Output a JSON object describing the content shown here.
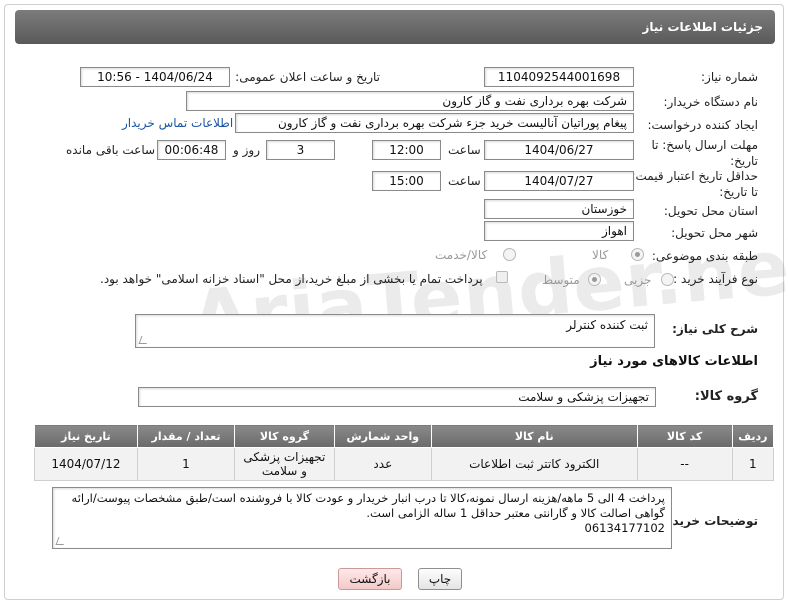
{
  "header": {
    "title": "جزئیات اطلاعات نیاز"
  },
  "form": {
    "need_number": {
      "label": "شماره نیاز:",
      "value": "1104092544001698"
    },
    "announce_datetime": {
      "label": "تاریخ و ساعت اعلان عمومی:",
      "value": "1404/06/24 - 10:56"
    },
    "buyer_org": {
      "label": "نام دستگاه خریدار:",
      "value": "شرکت بهره برداری نفت و گاز کارون"
    },
    "requester": {
      "label": "ایجاد کننده درخواست:",
      "value": "پیغام پوراتیان آنالیست خرید جزء شرکت بهره برداری نفت و گاز کارون",
      "contact_link": "اطلاعات تماس خریدار"
    },
    "reply_deadline": {
      "label": "مهلت ارسال پاسخ: تا تاریخ:",
      "date": "1404/06/27",
      "time_label": "ساعت",
      "time": "12:00",
      "days": "3",
      "days_label": "روز و",
      "remaining": "00:06:48",
      "remaining_label": "ساعت باقی مانده"
    },
    "price_validity": {
      "label": "حداقل تاریخ اعتبار قیمت: تا تاریخ:",
      "date": "1404/07/27",
      "time_label": "ساعت",
      "time": "15:00"
    },
    "province": {
      "label": "استان محل تحویل:",
      "value": "خوزستان"
    },
    "city": {
      "label": "شهر محل تحویل:",
      "value": "اهواز"
    },
    "category": {
      "label": "طبقه بندی موضوعی:",
      "options": [
        "کالا",
        "کالا/خدمت"
      ],
      "selected": "کالا"
    },
    "process": {
      "label": "نوع فرآیند خرید :",
      "options": [
        "جزیی",
        "متوسط"
      ],
      "selected": "متوسط",
      "payment_note": "پرداخت تمام یا بخشی از مبلغ خرید،از محل \"اسناد خزانه اسلامی\" خواهد بود."
    }
  },
  "need_desc": {
    "label": "شرح کلی نیاز:",
    "value": "ثبت کننده کنترلر"
  },
  "goods_section": {
    "title": "اطلاعات کالاهای مورد نیاز"
  },
  "goods_group": {
    "label": "گروه کالا:",
    "value": "تجهیزات پزشکی و سلامت"
  },
  "table": {
    "headers": [
      "ردیف",
      "کد کالا",
      "نام کالا",
      "واحد شمارش",
      "گروه کالا",
      "تعداد / مقدار",
      "تاریخ نیاز"
    ],
    "rows": [
      [
        "1",
        "--",
        "الکترود کاتتر ثبت اطلاعات",
        "عدد",
        "تجهیزات پزشکی و سلامت",
        "1",
        "1404/07/12"
      ]
    ]
  },
  "buyer_notes": {
    "label": "توضیحات خریدار:",
    "lines": [
      "پرداخت 4 الی 5 ماهه/هزینه ارسال نمونه،کالا تا درب انبار خریدار و عودت کالا با فروشنده است/طبق مشخصات پیوست/ارائه",
      "گواهی اصالت کالا و گارانتی معتبر حداقل 1 ساله الزامی است.",
      "06134177102"
    ]
  },
  "buttons": {
    "print": "چاپ",
    "back": "بازگشت"
  },
  "watermark": {
    "text": "AriaTender.neT"
  }
}
